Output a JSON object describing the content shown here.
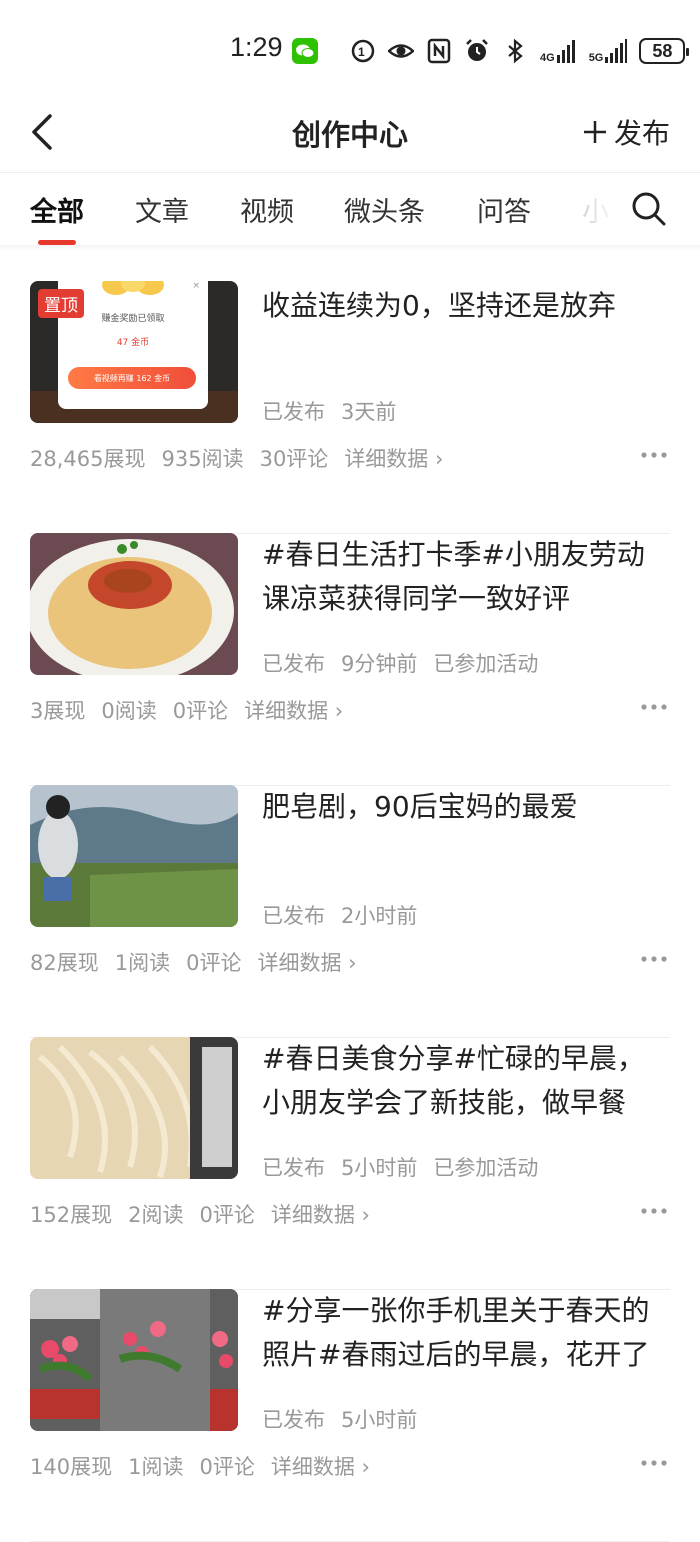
{
  "status_bar": {
    "time": "1:29",
    "battery": "58",
    "net1": "4G",
    "net2": "5G"
  },
  "header": {
    "title": "创作中心",
    "publish_label": "发布"
  },
  "tabs": [
    {
      "label": "全部",
      "active": true
    },
    {
      "label": "文章"
    },
    {
      "label": "视频"
    },
    {
      "label": "微头条"
    },
    {
      "label": "问答"
    },
    {
      "label": "小"
    }
  ],
  "articles": [
    {
      "title": "收益连续为0，坚持还是放弃",
      "pinned": true,
      "pin_label": "置顶",
      "thumb_popup": {
        "line1": "赚金奖励已领取",
        "line2": "47 金币",
        "button": "看视频再赚 162 金币",
        "close": "×"
      },
      "status": "已发布",
      "time": "3天前",
      "activity": "",
      "impressions": "28,465展现",
      "reads": "935阅读",
      "comments": "30评论",
      "detail": "详细数据 ›"
    },
    {
      "title": "#春日生活打卡季#小朋友劳动课凉菜获得同学一致好评",
      "status": "已发布",
      "time": "9分钟前",
      "activity": "已参加活动",
      "impressions": "3展现",
      "reads": "0阅读",
      "comments": "0评论",
      "detail": "详细数据 ›"
    },
    {
      "title": "肥皂剧，90后宝妈的最爱",
      "status": "已发布",
      "time": "2小时前",
      "activity": "",
      "impressions": "82展现",
      "reads": "1阅读",
      "comments": "0评论",
      "detail": "详细数据 ›"
    },
    {
      "title": "#春日美食分享#忙碌的早晨，小朋友学会了新技能，做早餐",
      "status": "已发布",
      "time": "5小时前",
      "activity": "已参加活动",
      "impressions": "152展现",
      "reads": "2阅读",
      "comments": "0评论",
      "detail": "详细数据 ›"
    },
    {
      "title": "#分享一张你手机里关于春天的照片#春雨过后的早晨，花开了",
      "status": "已发布",
      "time": "5小时前",
      "activity": "",
      "impressions": "140展现",
      "reads": "1阅读",
      "comments": "0评论",
      "detail": "详细数据 ›"
    }
  ]
}
